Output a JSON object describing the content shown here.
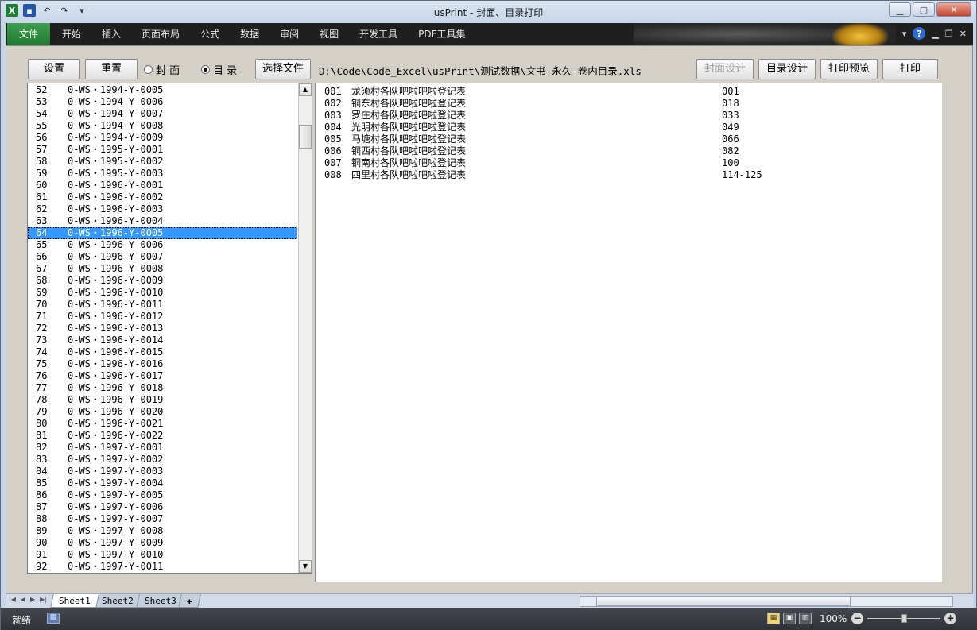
{
  "window": {
    "title": "usPrint - 封面、目录打印"
  },
  "qat": {
    "excel_icon": "X",
    "save_icon": "save-icon",
    "undo_icon": "↶",
    "redo_icon": "↷",
    "customize_icon": "▾"
  },
  "ribbon": {
    "tabs": [
      "文件",
      "开始",
      "插入",
      "页面布局",
      "公式",
      "数据",
      "审阅",
      "视图",
      "开发工具",
      "PDF工具集"
    ],
    "help_icon": "?"
  },
  "toolbar": {
    "settings_label": "设置",
    "reset_label": "重置",
    "cover_radio_label": "封 面",
    "toc_radio_label": "目 录",
    "cover_selected": false,
    "toc_selected": true,
    "choose_file_label": "选择文件",
    "file_path": "D:\\Code\\Code_Excel\\usPrint\\测试数据\\文书-永久-卷内目录.xls",
    "cover_design_label": "封面设计",
    "toc_design_label": "目录设计",
    "print_preview_label": "打印预览",
    "print_label": "打印"
  },
  "list": {
    "selected_index": 12,
    "rows": [
      {
        "num": "52",
        "code": "0-WS・1994-Y-0005"
      },
      {
        "num": "53",
        "code": "0-WS・1994-Y-0006"
      },
      {
        "num": "54",
        "code": "0-WS・1994-Y-0007"
      },
      {
        "num": "55",
        "code": "0-WS・1994-Y-0008"
      },
      {
        "num": "56",
        "code": "0-WS・1994-Y-0009"
      },
      {
        "num": "57",
        "code": "0-WS・1995-Y-0001"
      },
      {
        "num": "58",
        "code": "0-WS・1995-Y-0002"
      },
      {
        "num": "59",
        "code": "0-WS・1995-Y-0003"
      },
      {
        "num": "60",
        "code": "0-WS・1996-Y-0001"
      },
      {
        "num": "61",
        "code": "0-WS・1996-Y-0002"
      },
      {
        "num": "62",
        "code": "0-WS・1996-Y-0003"
      },
      {
        "num": "63",
        "code": "0-WS・1996-Y-0004"
      },
      {
        "num": "64",
        "code": "0-WS・1996-Y-0005"
      },
      {
        "num": "65",
        "code": "0-WS・1996-Y-0006"
      },
      {
        "num": "66",
        "code": "0-WS・1996-Y-0007"
      },
      {
        "num": "67",
        "code": "0-WS・1996-Y-0008"
      },
      {
        "num": "68",
        "code": "0-WS・1996-Y-0009"
      },
      {
        "num": "69",
        "code": "0-WS・1996-Y-0010"
      },
      {
        "num": "70",
        "code": "0-WS・1996-Y-0011"
      },
      {
        "num": "71",
        "code": "0-WS・1996-Y-0012"
      },
      {
        "num": "72",
        "code": "0-WS・1996-Y-0013"
      },
      {
        "num": "73",
        "code": "0-WS・1996-Y-0014"
      },
      {
        "num": "74",
        "code": "0-WS・1996-Y-0015"
      },
      {
        "num": "75",
        "code": "0-WS・1996-Y-0016"
      },
      {
        "num": "76",
        "code": "0-WS・1996-Y-0017"
      },
      {
        "num": "77",
        "code": "0-WS・1996-Y-0018"
      },
      {
        "num": "78",
        "code": "0-WS・1996-Y-0019"
      },
      {
        "num": "79",
        "code": "0-WS・1996-Y-0020"
      },
      {
        "num": "80",
        "code": "0-WS・1996-Y-0021"
      },
      {
        "num": "81",
        "code": "0-WS・1996-Y-0022"
      },
      {
        "num": "82",
        "code": "0-WS・1997-Y-0001"
      },
      {
        "num": "83",
        "code": "0-WS・1997-Y-0002"
      },
      {
        "num": "84",
        "code": "0-WS・1997-Y-0003"
      },
      {
        "num": "85",
        "code": "0-WS・1997-Y-0004"
      },
      {
        "num": "86",
        "code": "0-WS・1997-Y-0005"
      },
      {
        "num": "87",
        "code": "0-WS・1997-Y-0006"
      },
      {
        "num": "88",
        "code": "0-WS・1997-Y-0007"
      },
      {
        "num": "89",
        "code": "0-WS・1997-Y-0008"
      },
      {
        "num": "90",
        "code": "0-WS・1997-Y-0009"
      },
      {
        "num": "91",
        "code": "0-WS・1997-Y-0010"
      },
      {
        "num": "92",
        "code": "0-WS・1997-Y-0011"
      }
    ]
  },
  "detail": {
    "rows": [
      {
        "num": "001",
        "title": "龙须村各队吧啦吧啦登记表",
        "page": "001"
      },
      {
        "num": "002",
        "title": "铜东村各队吧啦吧啦登记表",
        "page": "018"
      },
      {
        "num": "003",
        "title": "罗庄村各队吧啦吧啦登记表",
        "page": "033"
      },
      {
        "num": "004",
        "title": "光明村各队吧啦吧啦登记表",
        "page": "049"
      },
      {
        "num": "005",
        "title": "马塘村各队吧啦吧啦登记表",
        "page": "066"
      },
      {
        "num": "006",
        "title": "铜西村各队吧啦吧啦登记表",
        "page": "082"
      },
      {
        "num": "007",
        "title": "铜南村各队吧啦吧啦登记表",
        "page": "100"
      },
      {
        "num": "008",
        "title": "四里村各队吧啦吧啦登记表",
        "page": "114-125"
      }
    ]
  },
  "sheets": {
    "tabs": [
      "Sheet1",
      "Sheet2",
      "Sheet3"
    ],
    "active": 0
  },
  "status": {
    "ready_text": "就绪",
    "zoom": "100%",
    "zoom_minus": "−",
    "zoom_plus": "+"
  }
}
